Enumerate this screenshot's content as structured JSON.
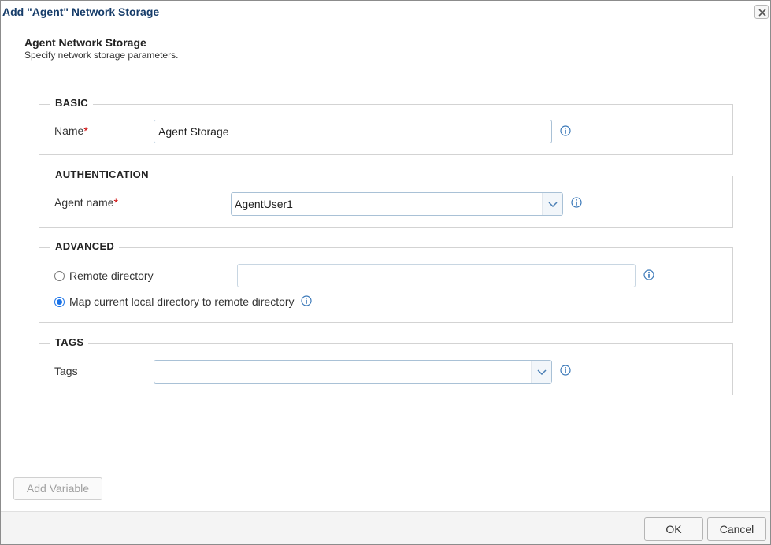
{
  "dialog": {
    "title": "Add \"Agent\" Network Storage",
    "close_icon": "close-icon"
  },
  "header": {
    "title": "Agent Network Storage",
    "subtitle": "Specify network storage parameters."
  },
  "basic": {
    "legend": "BASIC",
    "name_label": "Name",
    "required_mark": "*",
    "name_value": "Agent Storage"
  },
  "authentication": {
    "legend": "AUTHENTICATION",
    "agent_label": "Agent name",
    "required_mark": "*",
    "agent_value": "AgentUser1"
  },
  "advanced": {
    "legend": "ADVANCED",
    "remote_dir_label": "Remote directory",
    "remote_dir_value": "",
    "map_label": "Map current local directory to remote directory",
    "selected_option": "map"
  },
  "tags": {
    "legend": "TAGS",
    "tags_label": "Tags",
    "tags_value": ""
  },
  "buttons": {
    "add_variable": "Add Variable",
    "ok": "OK",
    "cancel": "Cancel"
  },
  "colors": {
    "title_text": "#173d6a",
    "required": "#cc0000",
    "radio_selected": "#1a73e8",
    "info_icon": "#3a78b8"
  }
}
